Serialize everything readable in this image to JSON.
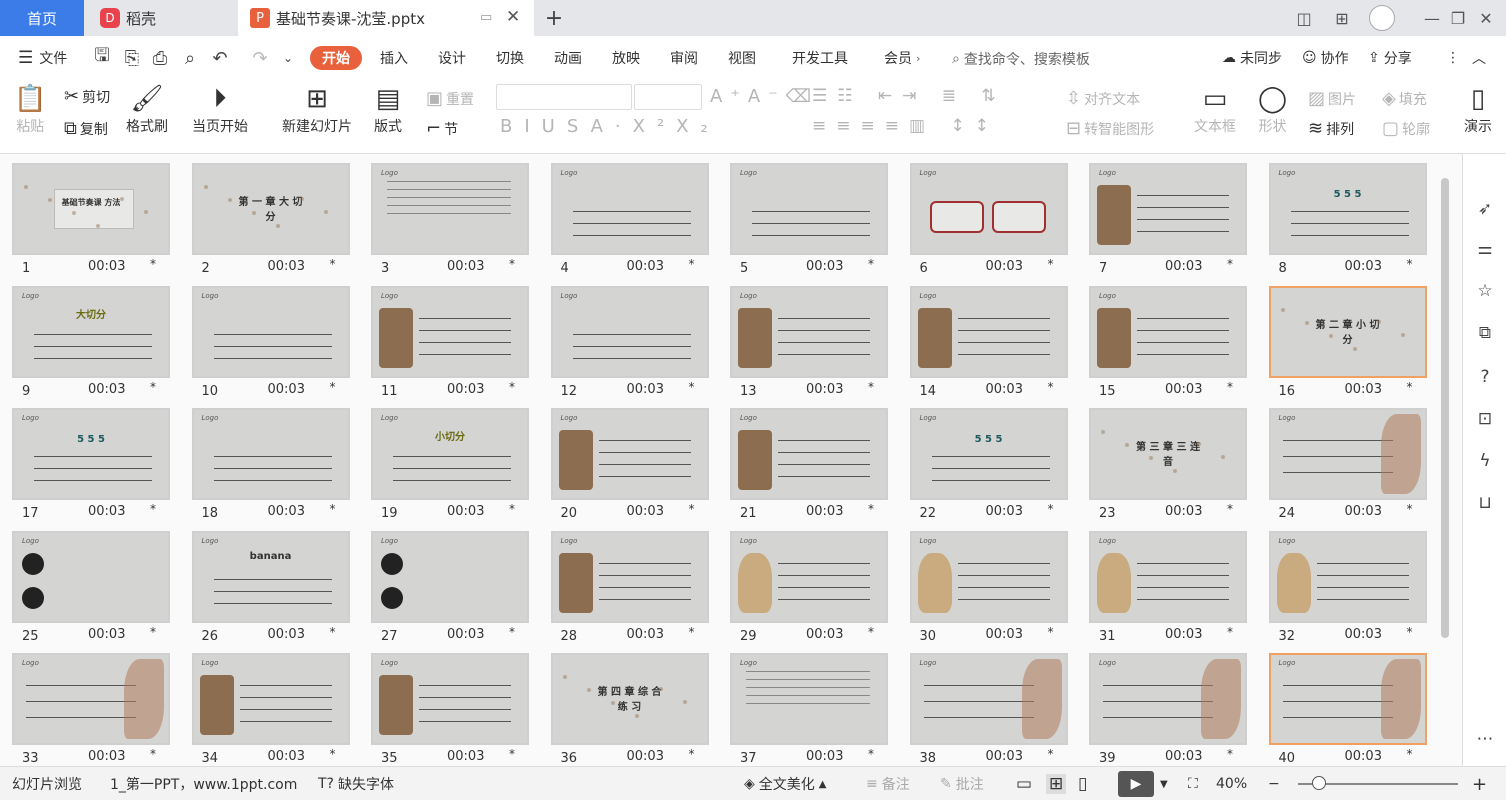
{
  "tabs": {
    "home": "首页",
    "daoke": "稻壳",
    "file": "基础节奏课-沈莹.pptx"
  },
  "menu": {
    "file": "文件",
    "items": [
      "开始",
      "插入",
      "设计",
      "切换",
      "动画",
      "放映",
      "审阅",
      "视图",
      "开发工具",
      "会员"
    ],
    "search_placeholder": "查找命令、搜索模板",
    "unsynced": "未同步",
    "collab": "协作",
    "share": "分享"
  },
  "ribbon": {
    "paste": "粘贴",
    "cut": "剪切",
    "copy": "复制",
    "format_painter": "格式刷",
    "from_current": "当页开始",
    "new_slide": "新建幻灯片",
    "layout": "版式",
    "section": "节",
    "reset": "重置",
    "align_text": "对齐文本",
    "smart_art": "转智能图形",
    "text_box": "文本框",
    "shape": "形状",
    "arrange": "排列",
    "picture": "图片",
    "fill": "填充",
    "outline": "轮廓",
    "slideshow": "演示"
  },
  "slides": [
    {
      "n": "1",
      "t": "00:03",
      "title": "基础节奏课 方法",
      "kind": "title"
    },
    {
      "n": "2",
      "t": "00:03",
      "title": "第 一 章 大 切 分",
      "kind": "chapter"
    },
    {
      "n": "3",
      "t": "00:03",
      "kind": "text"
    },
    {
      "n": "4",
      "t": "00:03",
      "kind": "rhythm"
    },
    {
      "n": "5",
      "t": "00:03",
      "kind": "rhythm"
    },
    {
      "n": "6",
      "t": "00:03",
      "kind": "boxes"
    },
    {
      "n": "7",
      "t": "00:03",
      "kind": "guitarist"
    },
    {
      "n": "8",
      "t": "00:03",
      "title": "5 5 5",
      "kind": "numbers"
    },
    {
      "n": "9",
      "t": "00:03",
      "title": "大切分",
      "kind": "notes"
    },
    {
      "n": "10",
      "t": "00:03",
      "kind": "rhythm"
    },
    {
      "n": "11",
      "t": "00:03",
      "kind": "phono"
    },
    {
      "n": "12",
      "t": "00:03",
      "kind": "rhythm"
    },
    {
      "n": "13",
      "t": "00:03",
      "kind": "phono"
    },
    {
      "n": "14",
      "t": "00:03",
      "kind": "phono"
    },
    {
      "n": "15",
      "t": "00:03",
      "kind": "phono"
    },
    {
      "n": "16",
      "t": "00:03",
      "title": "第 二 章 小 切 分",
      "kind": "chapter",
      "sel": true
    },
    {
      "n": "17",
      "t": "00:03",
      "title": "5 5 5",
      "kind": "numbers"
    },
    {
      "n": "18",
      "t": "00:03",
      "kind": "notes"
    },
    {
      "n": "19",
      "t": "00:03",
      "title": "小切分",
      "kind": "notes"
    },
    {
      "n": "20",
      "t": "00:03",
      "kind": "phono"
    },
    {
      "n": "21",
      "t": "00:03",
      "kind": "phono"
    },
    {
      "n": "22",
      "t": "00:03",
      "title": "5 5 5",
      "kind": "numbers"
    },
    {
      "n": "23",
      "t": "00:03",
      "title": "第 三 章 三 连 音",
      "kind": "chapter"
    },
    {
      "n": "24",
      "t": "00:03",
      "kind": "score"
    },
    {
      "n": "25",
      "t": "00:03",
      "kind": "record"
    },
    {
      "n": "26",
      "t": "00:03",
      "title": "banana",
      "kind": "notes"
    },
    {
      "n": "27",
      "t": "00:03",
      "kind": "record"
    },
    {
      "n": "28",
      "t": "00:03",
      "kind": "phono"
    },
    {
      "n": "29",
      "t": "00:03",
      "kind": "guitar"
    },
    {
      "n": "30",
      "t": "00:03",
      "kind": "guitar"
    },
    {
      "n": "31",
      "t": "00:03",
      "kind": "guitar"
    },
    {
      "n": "32",
      "t": "00:03",
      "kind": "guitar"
    },
    {
      "n": "33",
      "t": "00:03",
      "kind": "score"
    },
    {
      "n": "34",
      "t": "00:03",
      "kind": "guitarist"
    },
    {
      "n": "35",
      "t": "00:03",
      "kind": "guitarist"
    },
    {
      "n": "36",
      "t": "00:03",
      "title": "第 四 章 综 合 练 习",
      "kind": "chapter"
    },
    {
      "n": "37",
      "t": "00:03",
      "kind": "text"
    },
    {
      "n": "38",
      "t": "00:03",
      "kind": "staff"
    },
    {
      "n": "39",
      "t": "00:03",
      "kind": "staff"
    },
    {
      "n": "40",
      "t": "00:03",
      "kind": "staff",
      "sel": true
    }
  ],
  "status": {
    "view": "幻灯片浏览",
    "theme": "1_第一PPT，www.1ppt.com",
    "missing_font": "缺失字体",
    "beautify": "全文美化",
    "notes": "备注",
    "comment": "批注",
    "zoom": "40%"
  }
}
